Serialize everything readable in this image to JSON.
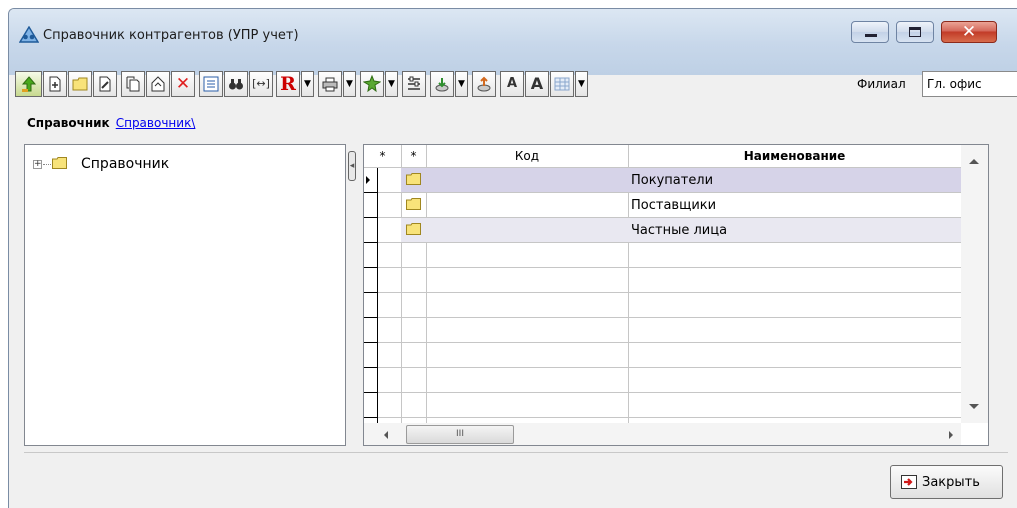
{
  "window": {
    "title": "Справочник контрагентов (УПР учет)",
    "accent": "#c7d7ea"
  },
  "toolbar": {
    "buttons": [
      {
        "name": "arrow-up-green-icon"
      },
      {
        "name": "new-item-icon"
      },
      {
        "name": "new-folder-icon"
      },
      {
        "name": "edit-item-icon"
      },
      {
        "name": "copy-item-icon"
      },
      {
        "name": "move-item-icon"
      },
      {
        "name": "delete-icon",
        "color": "#e02020"
      },
      {
        "name": "list-view-icon"
      },
      {
        "name": "binoculars-icon"
      },
      {
        "name": "fit-columns-icon"
      },
      {
        "name": "report-icon",
        "glyph": "R",
        "color": "#cc0000"
      },
      {
        "name": "print-icon"
      },
      {
        "name": "settings-icon"
      },
      {
        "name": "filter-icon"
      },
      {
        "name": "import-icon"
      },
      {
        "name": "export-icon"
      },
      {
        "name": "font-decrease-icon",
        "glyph": "A"
      },
      {
        "name": "font-increase-icon",
        "glyph": "A"
      },
      {
        "name": "grid-icon"
      }
    ],
    "branch_label": "Филиал",
    "branch_value": "Гл. офис"
  },
  "breadcrumb": {
    "label": "Справочник",
    "link": "Справочник\\"
  },
  "tree": {
    "root_label": "Справочник",
    "expander": "+"
  },
  "grid": {
    "columns": [
      "*",
      "*",
      "Код",
      "Наименование"
    ],
    "rows": [
      {
        "code": "",
        "name": "Покупатели",
        "selected": true
      },
      {
        "code": "",
        "name": "Поставщики",
        "selected": false
      },
      {
        "code": "",
        "name": "Частные лица",
        "selected": false
      }
    ],
    "selected_row_color": "#d6d3e8",
    "scrollbar_glyph": "III"
  },
  "footer": {
    "close_label": "Закрыть"
  }
}
